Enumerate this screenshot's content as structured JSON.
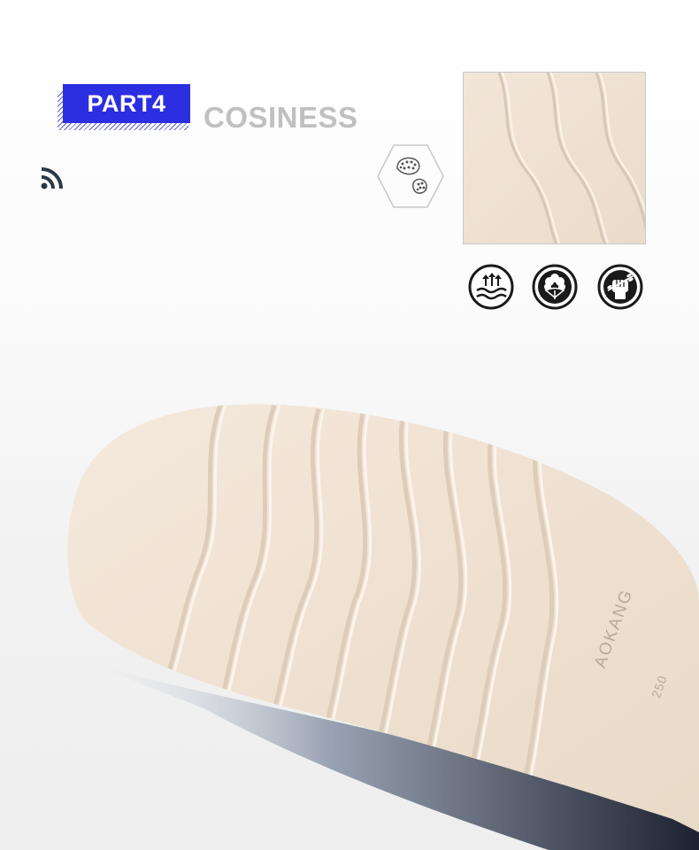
{
  "header": {
    "badge_label": "PART4",
    "title": "COSINESS"
  },
  "icons": {
    "feed": "rss-feed-icon",
    "hexagon": "shoe-sole-hexagon-icon",
    "features": [
      "breathable-waves-icon",
      "cotton-comfort-icon",
      "durable-fist-icon"
    ]
  },
  "sole": {
    "brand_text": "AOKANG",
    "size_text": "250"
  },
  "colors": {
    "badge": "#2c2ee2",
    "title": "#c0c0c0",
    "sole": "#efe2d2",
    "shoe_upper": "#2b2f3a"
  }
}
